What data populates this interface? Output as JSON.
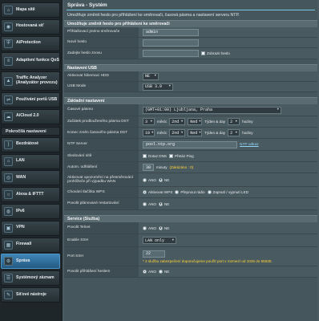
{
  "sidebar": {
    "top_items": [
      {
        "label": "Mapa sítě",
        "icon": "network-map-icon"
      },
      {
        "label": "Hostovaná síť",
        "icon": "guest-network-icon"
      },
      {
        "label": "AiProtection",
        "icon": "shield-icon"
      },
      {
        "label": "Adaptivní funkce QoS",
        "icon": "qos-icon"
      },
      {
        "label": "Traffic Analyzer (Analyzátor provozu)",
        "icon": "traffic-analyzer-icon"
      },
      {
        "label": "Používání portů USB",
        "icon": "usb-icon"
      },
      {
        "label": "AiCloud 2.0",
        "icon": "cloud-icon"
      }
    ],
    "section_title": "Pokročilá nastavení",
    "advanced_items": [
      {
        "label": "Bezdrátové",
        "icon": "wireless-icon"
      },
      {
        "label": "LAN",
        "icon": "lan-icon"
      },
      {
        "label": "WAN",
        "icon": "wan-icon"
      },
      {
        "label": "Alexa & IFTTT",
        "icon": "alexa-icon"
      },
      {
        "label": "IPv6",
        "icon": "ipv6-icon"
      },
      {
        "label": "VPN",
        "icon": "vpn-icon"
      },
      {
        "label": "Firewall",
        "icon": "firewall-icon"
      },
      {
        "label": "Správa",
        "icon": "administration-icon",
        "active": true
      },
      {
        "label": "Systémový záznam",
        "icon": "system-log-icon"
      },
      {
        "label": "Síťové nástroje",
        "icon": "network-tools-icon"
      }
    ]
  },
  "page": {
    "title": "Správa - Systém",
    "description": "Umožňuje změnit heslo pro přihlášení ke směrovači, časová pásma a nastavení serveru NTP."
  },
  "login": {
    "header": "Umožňuje změnit heslo pro přihlášení ke směrovači",
    "username_label": "Přihlašovací jméno směrovače",
    "username_value": "admin",
    "new_password_label": "Nové heslo",
    "new_password_value": "",
    "retype_label": "Zadejte heslo znovu",
    "retype_value": "",
    "show_password": "Zobrazit heslo"
  },
  "usb": {
    "header": "Nastavení USB",
    "hdd_hibernation_label": "Aktivovat hibernaci HDD",
    "hdd_hibernation_value": "NE",
    "usb_mode_label": "USB Mode",
    "usb_mode_value": "USB 3.0"
  },
  "basic": {
    "header": "Základní nastavení",
    "timezone_label": "Časové pásmo",
    "timezone_value": "(GMT+01:00) Ljubljana, Praha",
    "dst_start_label": "Začátek prodlouženého pásma DST",
    "dst_start": {
      "month": "3",
      "month_unit": "měsíc",
      "week": "2nd",
      "week_unit": "Ned",
      "day_label": "Týden & day",
      "hour": "2",
      "hour_unit": "hodiny"
    },
    "dst_end_label": "Konec změn časového pásma DST",
    "dst_end": {
      "month": "10",
      "month_unit": "měsíc",
      "week": "2nd",
      "week_unit": "Ned",
      "day_label": "Týden & day",
      "hour": "2",
      "hour_unit": "hodiny"
    },
    "ntp_label": "NTP Server",
    "ntp_value": "pool.ntp.org",
    "ntp_link": "NTP odkaz",
    "network_monitoring_label": "Sledování sítě",
    "dns_query": "Dotaz DNS",
    "ping": "Přetáz Ping",
    "auto_logout_label": "Autom. odhlášení",
    "auto_logout_value": "30",
    "auto_logout_unit": "minuty",
    "auto_logout_note": "(Zakázáno : 0)",
    "wan_notify_label": "Aktivovat upozornění na přesměrování prohlížeče při výpadku WAN",
    "wan_notify_yes": "ANO",
    "wan_notify_no": "NE",
    "wps_label": "Chování tlačítka WPS",
    "wps_options": [
      "Aktivovat WPS",
      "Přepnout rádio",
      "Zapnutí / vypnutí LED"
    ],
    "reboot_label": "Povolit plánované restartování",
    "reboot_yes": "ANO",
    "reboot_no": "NE"
  },
  "service": {
    "header": "Service (Služba)",
    "telnet_label": "Povolit Telnet",
    "telnet_yes": "ANO",
    "telnet_no": "NE",
    "ssh_label": "Enable SSH",
    "ssh_value": "LAN only",
    "ssh_port_label": "Port SSH",
    "ssh_port_value": "22",
    "ssh_port_note": "* 2 službu zabezpečení doporučujeme použít port v rozmezí od 1025 do 65535.",
    "login_label": "Povolit přihlášení heslem",
    "login_yes": "ANO",
    "login_no": "NE"
  }
}
